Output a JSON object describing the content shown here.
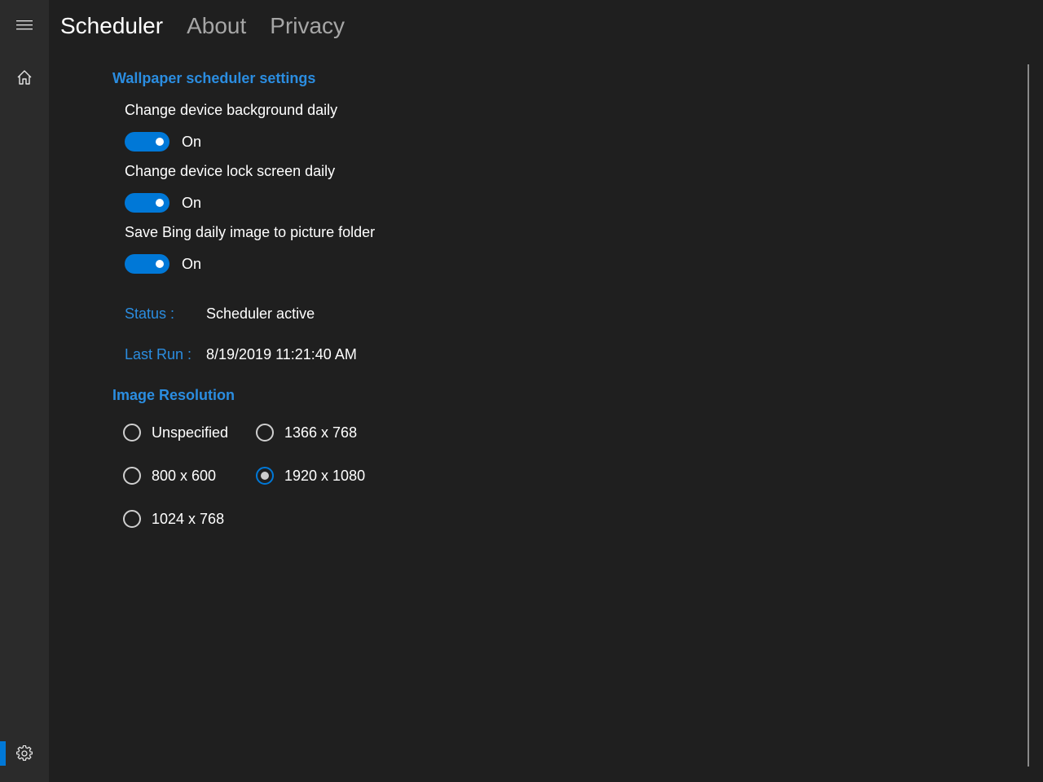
{
  "nav": {
    "hamburger_icon": "hamburger-menu-icon",
    "home_icon": "home-icon",
    "settings_icon": "gear-icon",
    "accent_color": "#0078d7"
  },
  "pivot": {
    "tabs": [
      {
        "label": "Scheduler",
        "active": true
      },
      {
        "label": "About",
        "active": false
      },
      {
        "label": "Privacy",
        "active": false
      }
    ]
  },
  "wallpaper_section": {
    "header": "Wallpaper scheduler settings",
    "settings": [
      {
        "label": "Change device background daily",
        "state": "On"
      },
      {
        "label": "Change device lock screen daily",
        "state": "On"
      },
      {
        "label": "Save Bing daily image to picture folder",
        "state": "On"
      }
    ],
    "status_key": "Status :",
    "status_value": "Scheduler active",
    "last_run_key": "Last Run :",
    "last_run_value": "8/19/2019 11:21:40 AM"
  },
  "resolution_section": {
    "header": "Image Resolution",
    "options": [
      {
        "label": "Unspecified",
        "checked": false
      },
      {
        "label": "1366 x 768",
        "checked": false
      },
      {
        "label": "800 x 600",
        "checked": false
      },
      {
        "label": "1920 x 1080",
        "checked": true
      },
      {
        "label": "1024 x 768",
        "checked": false
      }
    ]
  },
  "colors": {
    "accent": "#0078d7",
    "header_blue": "#2b8de0",
    "background": "#1f1f1f",
    "rail": "#2b2b2b"
  }
}
